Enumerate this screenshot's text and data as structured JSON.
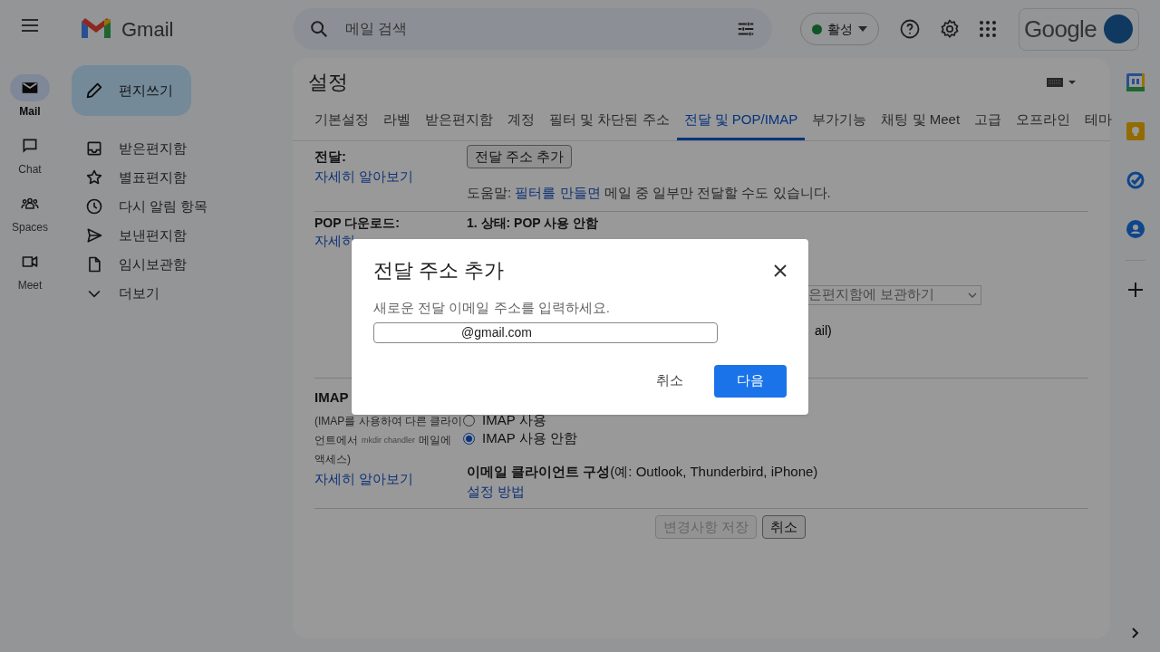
{
  "app": {
    "name": "Gmail"
  },
  "rail": [
    {
      "label": "Mail",
      "kind": "mail",
      "selected": true
    },
    {
      "label": "Chat",
      "kind": "chat",
      "selected": false
    },
    {
      "label": "Spaces",
      "kind": "spaces",
      "selected": false
    },
    {
      "label": "Meet",
      "kind": "meet",
      "selected": false
    }
  ],
  "compose": {
    "label": "편지쓰기"
  },
  "nav": [
    {
      "label": "받은편지함",
      "kind": "inbox"
    },
    {
      "label": "별표편지함",
      "kind": "star"
    },
    {
      "label": "다시 알림 항목",
      "kind": "clock"
    },
    {
      "label": "보낸편지함",
      "kind": "send"
    },
    {
      "label": "임시보관함",
      "kind": "draft"
    },
    {
      "label": "더보기",
      "kind": "more"
    }
  ],
  "search": {
    "placeholder": "메일 검색"
  },
  "status": {
    "label": "활성"
  },
  "account": {
    "brand": "Google"
  },
  "settings": {
    "title": "설정",
    "tabs": [
      {
        "label": "기본설정",
        "selected": false
      },
      {
        "label": "라벨",
        "selected": false
      },
      {
        "label": "받은편지함",
        "selected": false
      },
      {
        "label": "계정",
        "selected": false
      },
      {
        "label": "필터 및 차단된 주소",
        "selected": false
      },
      {
        "label": "전달 및 POP/IMAP",
        "selected": true
      },
      {
        "label": "부가기능",
        "selected": false
      },
      {
        "label": "채팅 및 Meet",
        "selected": false
      },
      {
        "label": "고급",
        "selected": false
      },
      {
        "label": "오프라인",
        "selected": false
      },
      {
        "label": "테마",
        "selected": false
      }
    ],
    "forwarding": {
      "label": "전달:",
      "learn_more": "자세히 알아보기",
      "add_button": "전달 주소 추가",
      "help": {
        "before": "도움말: ",
        "link": "필터를 만들면",
        "after": " 메일 중 일부만 전달할 수도 있습니다."
      }
    },
    "pop": {
      "label": "POP 다운로드:",
      "learn_more": "자세히",
      "status": "1. 상태: POP 사용 안함",
      "select_value": "은편지함에 보관하기",
      "note": "ail)"
    },
    "imap": {
      "label": "IMAP",
      "note": {
        "line1": "(IMAP를 사용하여 다른 클라이",
        "line2_before": "언트에서",
        "tag": "mkdir chandler",
        "line2_after": "메일에",
        "line3": "액세스)"
      },
      "learn_more": "자세히 알아보기",
      "options": [
        {
          "label": "IMAP 사용",
          "selected": false
        },
        {
          "label": "IMAP 사용 안함",
          "selected": true
        }
      ],
      "client": "**이메일 클라이언트 구성**(예: Outlook, Thunderbird, iPhone)",
      "setup_link": "설정 방법"
    },
    "save_button": {
      "label": "변경사항 저장",
      "disabled": true
    },
    "cancel_button": {
      "label": "취소"
    }
  },
  "dialog": {
    "title": "전달 주소 추가",
    "prompt": "새로운 전달 이메일 주소를 입력하세요.",
    "value": "@gmail.com",
    "cancel": "취소",
    "next": "다음"
  }
}
